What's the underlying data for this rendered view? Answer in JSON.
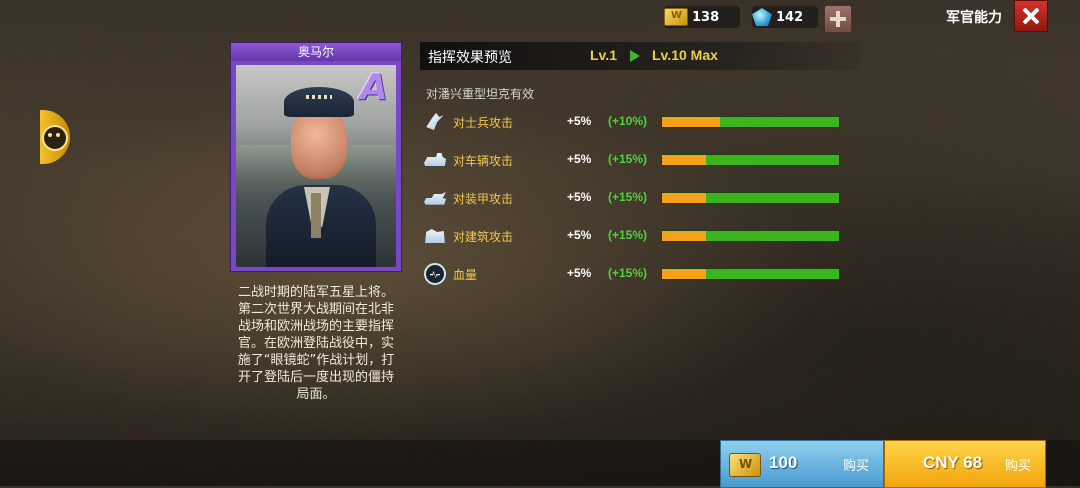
{
  "topbar": {
    "gold": "138",
    "gems": "142",
    "title": "军官能力"
  },
  "officer": {
    "name": "奥马尔",
    "rank": "A",
    "description": "二战时期的陆军五星上将。第二次世界大战期间在北非战场和欧洲战场的主要指挥官。在欧洲登陆战役中，实施了“眼镜蛇”作战计划，打开了登陆后一度出现的僵持局面。"
  },
  "preview": {
    "title": "指挥效果预览",
    "level_from": "Lv.1",
    "level_to": "Lv.10 Max",
    "note": "对潘兴重型坦克有效"
  },
  "stats": [
    {
      "icon": "soldier-icon",
      "label": "对士兵攻击",
      "base": "+5%",
      "bonus": "(+10%)",
      "progress": 0.33
    },
    {
      "icon": "vehicle-icon",
      "label": "对车辆攻击",
      "base": "+5%",
      "bonus": "(+15%)",
      "progress": 0.25
    },
    {
      "icon": "armor-icon",
      "label": "对装甲攻击",
      "base": "+5%",
      "bonus": "(+15%)",
      "progress": 0.25
    },
    {
      "icon": "building-icon",
      "label": "对建筑攻击",
      "base": "+5%",
      "bonus": "(+15%)",
      "progress": 0.25
    },
    {
      "icon": "heart-rate-icon",
      "label": "血量",
      "base": "+5%",
      "bonus": "(+15%)",
      "progress": 0.25
    }
  ],
  "purchase": {
    "gold_amount": "100",
    "gold_buy_label": "购买",
    "cny_price": "CNY 68",
    "cny_buy_label": "购买"
  },
  "colors": {
    "gain": "#f6a11c",
    "remaining": "#3bb41e",
    "label": "#f2c84a",
    "bonus": "#4fd23a"
  }
}
